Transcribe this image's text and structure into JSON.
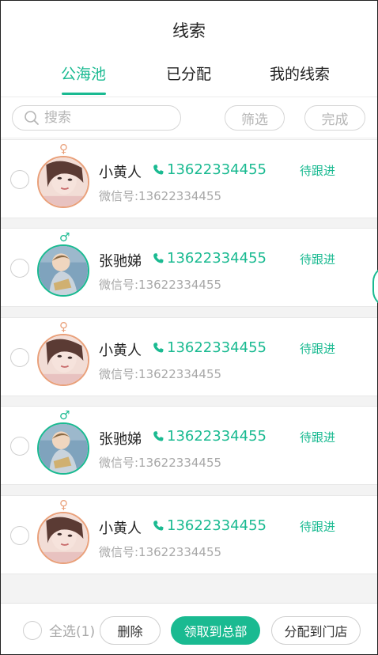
{
  "header": {
    "title": "线索"
  },
  "tabs": [
    {
      "label": "公海池",
      "active": true
    },
    {
      "label": "已分配",
      "active": false
    },
    {
      "label": "我的线索",
      "active": false
    }
  ],
  "toolbar": {
    "search_placeholder": "搜索",
    "filter_label": "筛选",
    "done_label": "完成"
  },
  "leads": [
    {
      "gender": "female",
      "gender_symbol": "♀",
      "name": "小黄人",
      "phone": "13622334455",
      "wechat": "微信号:13622334455",
      "status": "待跟进",
      "selected": false
    },
    {
      "gender": "male",
      "gender_symbol": "♂",
      "name": "张驰娣",
      "phone": "13622334455",
      "wechat": "微信号:13622334455",
      "status": "待跟进",
      "selected": false
    },
    {
      "gender": "female",
      "gender_symbol": "♀",
      "name": "小黄人",
      "phone": "13622334455",
      "wechat": "微信号:13622334455",
      "status": "待跟进",
      "selected": false
    },
    {
      "gender": "male",
      "gender_symbol": "♂",
      "name": "张驰娣",
      "phone": "13622334455",
      "wechat": "微信号:13622334455",
      "status": "待跟进",
      "selected": false
    },
    {
      "gender": "female",
      "gender_symbol": "♀",
      "name": "小黄人",
      "phone": "13622334455",
      "wechat": "微信号:13622334455",
      "status": "待跟进",
      "selected": false
    }
  ],
  "footer": {
    "select_all_label": "全选(1)",
    "delete_label": "删除",
    "claim_label": "领取到总部",
    "assign_label": "分配到门店"
  },
  "colors": {
    "accent": "#1aba91",
    "female": "#e9a07a",
    "muted": "#a8a8a8"
  },
  "icons": {
    "search": "search-icon",
    "phone": "phone-icon",
    "female": "female-gender-icon",
    "male": "male-gender-icon"
  }
}
